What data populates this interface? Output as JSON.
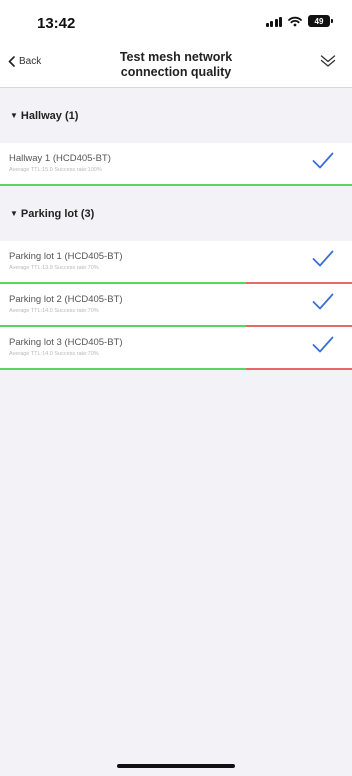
{
  "status": {
    "time": "13:42",
    "battery": "49"
  },
  "nav": {
    "back_label": "Back",
    "title_line1": "Test mesh network",
    "title_line2": "connection quality"
  },
  "groups": [
    {
      "header": "Hallway (1)",
      "items": [
        {
          "name": "Hallway 1 (HCD405-BT)",
          "detail": "Average TTL:15.0  Success rate:100%",
          "success_rate": 1.0
        }
      ]
    },
    {
      "header": "Parking lot (3)",
      "items": [
        {
          "name": "Parking lot 1 (HCD405-BT)",
          "detail": "Average TTL:13.9  Success rate:70%",
          "success_rate": 0.7
        },
        {
          "name": "Parking lot 2 (HCD405-BT)",
          "detail": "Average TTL:14.0  Success rate:70%",
          "success_rate": 0.7
        },
        {
          "name": "Parking lot 3 (HCD405-BT)",
          "detail": "Average TTL:14.0  Success rate:70%",
          "success_rate": 0.7
        }
      ]
    }
  ],
  "icons": {
    "back": "chevron-left-icon",
    "collapse": "double-chevron-down-icon",
    "check": "checkmark-icon",
    "caret": "caret-down-icon"
  },
  "colors": {
    "check": "#3a6fd8",
    "good": "#5ad65a",
    "bad": "#e26a6a"
  }
}
